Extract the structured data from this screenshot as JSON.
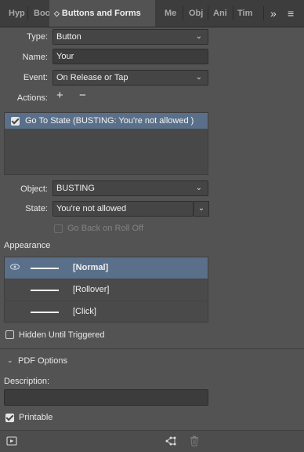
{
  "tabs": [
    {
      "label": "Hyp"
    },
    {
      "label": "Boo"
    },
    {
      "label": "Buttons and Forms"
    },
    {
      "label": "Me"
    },
    {
      "label": "Obj"
    },
    {
      "label": "Ani"
    },
    {
      "label": "Tim"
    }
  ],
  "tab_overflow": "»",
  "tab_menu": "≡",
  "type": {
    "label": "Type:",
    "value": "Button"
  },
  "name": {
    "label": "Name:",
    "value": "Your"
  },
  "event": {
    "label": "Event:",
    "value": "On Release or Tap"
  },
  "actions": {
    "label": "Actions:",
    "add": "+",
    "remove": "−",
    "items": [
      {
        "text": "Go To State (BUSTING: You're not allowed )",
        "checked": true
      }
    ]
  },
  "object": {
    "label": "Object:",
    "value": "BUSTING"
  },
  "state": {
    "label": "State:",
    "value": "You're not allowed"
  },
  "go_back": {
    "label": "Go Back on Roll Off"
  },
  "appearance": {
    "label": "Appearance",
    "items": [
      {
        "label": "[Normal]",
        "selected": true
      },
      {
        "label": "[Rollover]",
        "selected": false
      },
      {
        "label": "[Click]",
        "selected": false
      }
    ]
  },
  "hidden_until_triggered": {
    "label": "Hidden Until Triggered",
    "checked": false
  },
  "pdf_options": {
    "label": "PDF Options"
  },
  "description": {
    "label": "Description:",
    "value": ""
  },
  "printable": {
    "label": "Printable",
    "checked": true
  },
  "colors": {
    "selection": "#5a6f89",
    "panel": "#535353",
    "tabbar": "#3d3d3d"
  }
}
